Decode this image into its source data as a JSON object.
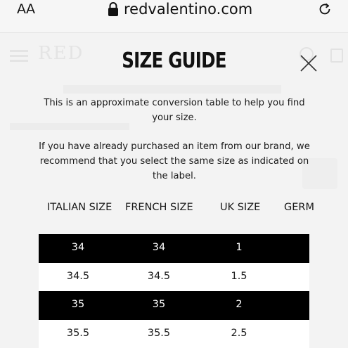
{
  "browser": {
    "text_size_label": "AA",
    "url": "redvalentino.com"
  },
  "modal": {
    "title": "SIZE GUIDE",
    "intro_1": "This is an approximate conversion table to help you find your size.",
    "intro_2": "If you have already purchased an item from our brand, we recommend that you select the same size as indicated on the label."
  },
  "table": {
    "headers": [
      "ITALIAN SIZE",
      "FRENCH SIZE",
      "UK SIZE",
      "GERM"
    ],
    "rows": [
      {
        "it": "34",
        "fr": "34",
        "uk": "1",
        "de": ""
      },
      {
        "it": "34.5",
        "fr": "34.5",
        "uk": "1.5",
        "de": ""
      },
      {
        "it": "35",
        "fr": "35",
        "uk": "2",
        "de": ""
      },
      {
        "it": "35.5",
        "fr": "35.5",
        "uk": "2.5",
        "de": ""
      }
    ]
  },
  "icons": {
    "lock": "lock-icon",
    "reload": "reload-icon",
    "close": "close-icon"
  },
  "colors": {
    "dark_row": "#000000",
    "text": "#1a1a1a",
    "background": "#ffffff"
  }
}
